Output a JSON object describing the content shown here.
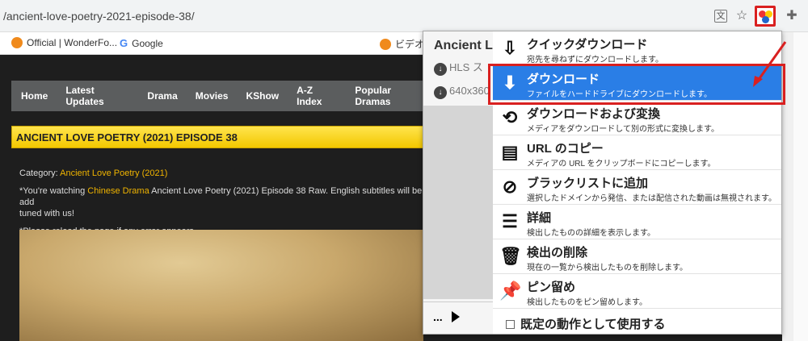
{
  "browser": {
    "url": "/ancient-love-poetry-2021-episode-38/",
    "bookmarks": [
      "Official | WonderFo...",
      "Google",
      "ビデオ &"
    ]
  },
  "site": {
    "nav": [
      "Home",
      "Latest Updates",
      "Drama",
      "Movies",
      "KShow",
      "A-Z Index",
      "Popular Dramas"
    ],
    "title": "ANCIENT LOVE POETRY (2021) EPISODE 38",
    "category_label": "Category: ",
    "category_value": "Ancient Love Poetry (2021)",
    "watching_prefix": "*You're watching ",
    "watching_link": "Chinese Drama",
    "watching_rest": " Ancient Love Poetry (2021) Episode 38 Raw. English subtitles will be add",
    "watching_cont": "tuned with us!",
    "reload": "*Please reload the page if any error appears."
  },
  "popup": {
    "title": "Ancient L",
    "line1": "HLS ス",
    "line2": "640x360",
    "more": "...",
    "menu": [
      {
        "title": "クイックダウンロード",
        "desc": "宛先を尋ねずにダウンロードします。",
        "icon": "quick-download-icon"
      },
      {
        "title": "ダウンロード",
        "desc": "ファイルをハードドライブにダウンロードします。",
        "icon": "download-icon"
      },
      {
        "title": "ダウンロードおよび変換",
        "desc": "メディアをダウンロードして別の形式に変換します。",
        "icon": "download-convert-icon"
      },
      {
        "title": "URL のコピー",
        "desc": "メディアの URL をクリップボードにコピーします。",
        "icon": "copy-url-icon"
      },
      {
        "title": "ブラックリストに追加",
        "desc": "選択したドメインから発信、または配信された動画は無視されます。",
        "icon": "blacklist-icon"
      },
      {
        "title": "詳細",
        "desc": "検出したものの詳細を表示します。",
        "icon": "details-icon"
      },
      {
        "title": "検出の削除",
        "desc": "現在の一覧から検出したものを削除します。",
        "icon": "trash-icon"
      },
      {
        "title": "ピン留め",
        "desc": "検出したものをピン留めします。",
        "icon": "pin-icon"
      }
    ],
    "default_action": "既定の動作として使用する"
  },
  "colors": {
    "accent": "#2a7ee6",
    "highlight": "#d92020",
    "title_bar": "#f3c800",
    "link": "#f0b400"
  }
}
